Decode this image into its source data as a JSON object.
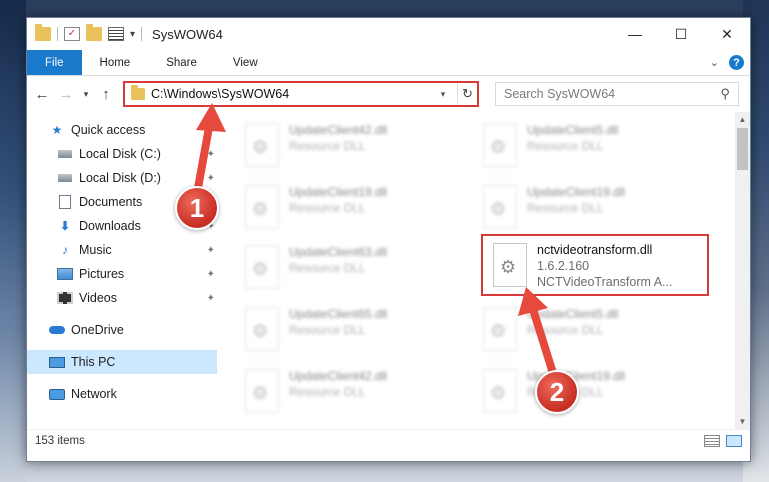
{
  "window": {
    "title": "SysWOW64",
    "controls": {
      "minimize": "—",
      "maximize": "☐",
      "close": "✕"
    }
  },
  "ribbon": {
    "tabs": [
      "File",
      "Home",
      "Share",
      "View"
    ],
    "help": "?"
  },
  "address": {
    "path": "C:\\Windows\\SysWOW64",
    "search_placeholder": "Search SysWOW64"
  },
  "sidebar": {
    "items": [
      {
        "label": "Quick access",
        "icon": "star-icon",
        "pinned": false
      },
      {
        "label": "Local Disk (C:)",
        "icon": "drive-icon",
        "pinned": true
      },
      {
        "label": "Local Disk (D:)",
        "icon": "drive-icon",
        "pinned": true
      },
      {
        "label": "Documents",
        "icon": "documents-icon",
        "pinned": true
      },
      {
        "label": "Downloads",
        "icon": "downloads-icon",
        "pinned": true
      },
      {
        "label": "Music",
        "icon": "music-icon",
        "pinned": true
      },
      {
        "label": "Pictures",
        "icon": "pictures-icon",
        "pinned": true
      },
      {
        "label": "Videos",
        "icon": "videos-icon",
        "pinned": true
      },
      {
        "label": "OneDrive",
        "icon": "onedrive-icon",
        "pinned": false
      },
      {
        "label": "This PC",
        "icon": "this-pc-icon",
        "pinned": false,
        "selected": true
      },
      {
        "label": "Network",
        "icon": "network-icon",
        "pinned": false
      }
    ]
  },
  "files": {
    "left_column": [
      {
        "name": "UpdateClient42.dll",
        "type": "Resource DLL"
      },
      {
        "name": "UpdateClient19.dll",
        "type": "Resource DLL"
      },
      {
        "name": "UpdateClient63.dll",
        "type": "Resource DLL"
      },
      {
        "name": "UpdateClient65.dll",
        "type": "Resource DLL"
      },
      {
        "name": "UpdateClient42.dll",
        "type": "Resource DLL"
      }
    ],
    "right_column": [
      {
        "name": "UpdateClient5.dll",
        "type": "Resource DLL"
      },
      {
        "name": "UpdateClient19.dll",
        "type": "Resource DLL"
      },
      {
        "name": "nctvideotransform.dll",
        "version": "1.6.2.160",
        "description": "NCTVideoTransform A..."
      },
      {
        "name": "UpdateClient5.dll",
        "type": "Resource DLL"
      },
      {
        "name": "UpdateClient19.dll",
        "type": "Resource DLL"
      }
    ]
  },
  "status": {
    "item_count": "153 items"
  },
  "annotations": {
    "step1": "1",
    "step2": "2"
  },
  "colors": {
    "accent": "#1979ca",
    "highlight": "#d83a3a",
    "selected_nav": "#cce8ff"
  }
}
